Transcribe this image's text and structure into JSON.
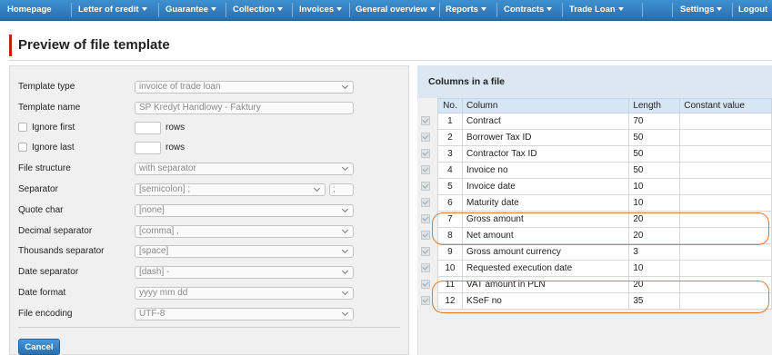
{
  "nav": {
    "items": [
      {
        "label": "Homepage",
        "dropdown": false
      },
      {
        "label": "Letter of credit",
        "dropdown": true
      },
      {
        "label": "Guarantee",
        "dropdown": true
      },
      {
        "label": "Collection",
        "dropdown": true
      },
      {
        "label": "Invoices",
        "dropdown": true
      },
      {
        "label": "General overview",
        "dropdown": true
      },
      {
        "label": "Reports",
        "dropdown": true
      },
      {
        "label": "Contracts",
        "dropdown": true
      },
      {
        "label": "Trade Loan",
        "dropdown": true
      },
      {
        "label": "Settings",
        "dropdown": true
      },
      {
        "label": "Logout",
        "dropdown": false
      }
    ]
  },
  "page": {
    "title": "Preview of file template"
  },
  "form": {
    "template_type": {
      "label": "Template type",
      "value": "invoice of trade loan"
    },
    "template_name": {
      "label": "Template name",
      "value": "SP Kredyt Handlowy - Faktury"
    },
    "ignore_first": {
      "label": "Ignore first",
      "unit": "rows"
    },
    "ignore_last": {
      "label": "Ignore last",
      "unit": "rows"
    },
    "file_structure": {
      "label": "File structure",
      "value": "with separator"
    },
    "separator": {
      "label": "Separator",
      "value": "[semicolon] ;",
      "custom": ";"
    },
    "quote_char": {
      "label": "Quote char",
      "value": "[none]"
    },
    "decimal_separator": {
      "label": "Decimal separator",
      "value": "[comma] ,"
    },
    "thousands_separator": {
      "label": "Thousands separator",
      "value": "[space]"
    },
    "date_separator": {
      "label": "Date separator",
      "value": "[dash] -"
    },
    "date_format": {
      "label": "Date format",
      "value": "yyyy mm dd"
    },
    "file_encoding": {
      "label": "File encoding",
      "value": "UTF-8"
    },
    "cancel_label": "Cancel"
  },
  "columns": {
    "title": "Columns in a file",
    "headers": {
      "no": "No.",
      "column": "Column",
      "length": "Length",
      "constant": "Constant value"
    },
    "rows": [
      {
        "no": "1",
        "column": "Contract",
        "length": "70",
        "constant": ""
      },
      {
        "no": "2",
        "column": "Borrower Tax ID",
        "length": "50",
        "constant": ""
      },
      {
        "no": "3",
        "column": "Contractor Tax ID",
        "length": "50",
        "constant": ""
      },
      {
        "no": "4",
        "column": "Invoice no",
        "length": "50",
        "constant": ""
      },
      {
        "no": "5",
        "column": "Invoice date",
        "length": "10",
        "constant": ""
      },
      {
        "no": "6",
        "column": "Maturity date",
        "length": "10",
        "constant": ""
      },
      {
        "no": "7",
        "column": "Gross amount",
        "length": "20",
        "constant": ""
      },
      {
        "no": "8",
        "column": "Net amount",
        "length": "20",
        "constant": ""
      },
      {
        "no": "9",
        "column": "Gross amount currency",
        "length": "3",
        "constant": ""
      },
      {
        "no": "10",
        "column": "Requested execution date",
        "length": "10",
        "constant": ""
      },
      {
        "no": "11",
        "column": "VAT amount in PLN",
        "length": "20",
        "constant": ""
      },
      {
        "no": "12",
        "column": "KSeF no",
        "length": "35",
        "constant": ""
      }
    ]
  },
  "colors": {
    "nav": "#2a6fb0",
    "title_accent": "#c81e1e",
    "highlight": "#e07a2c"
  }
}
